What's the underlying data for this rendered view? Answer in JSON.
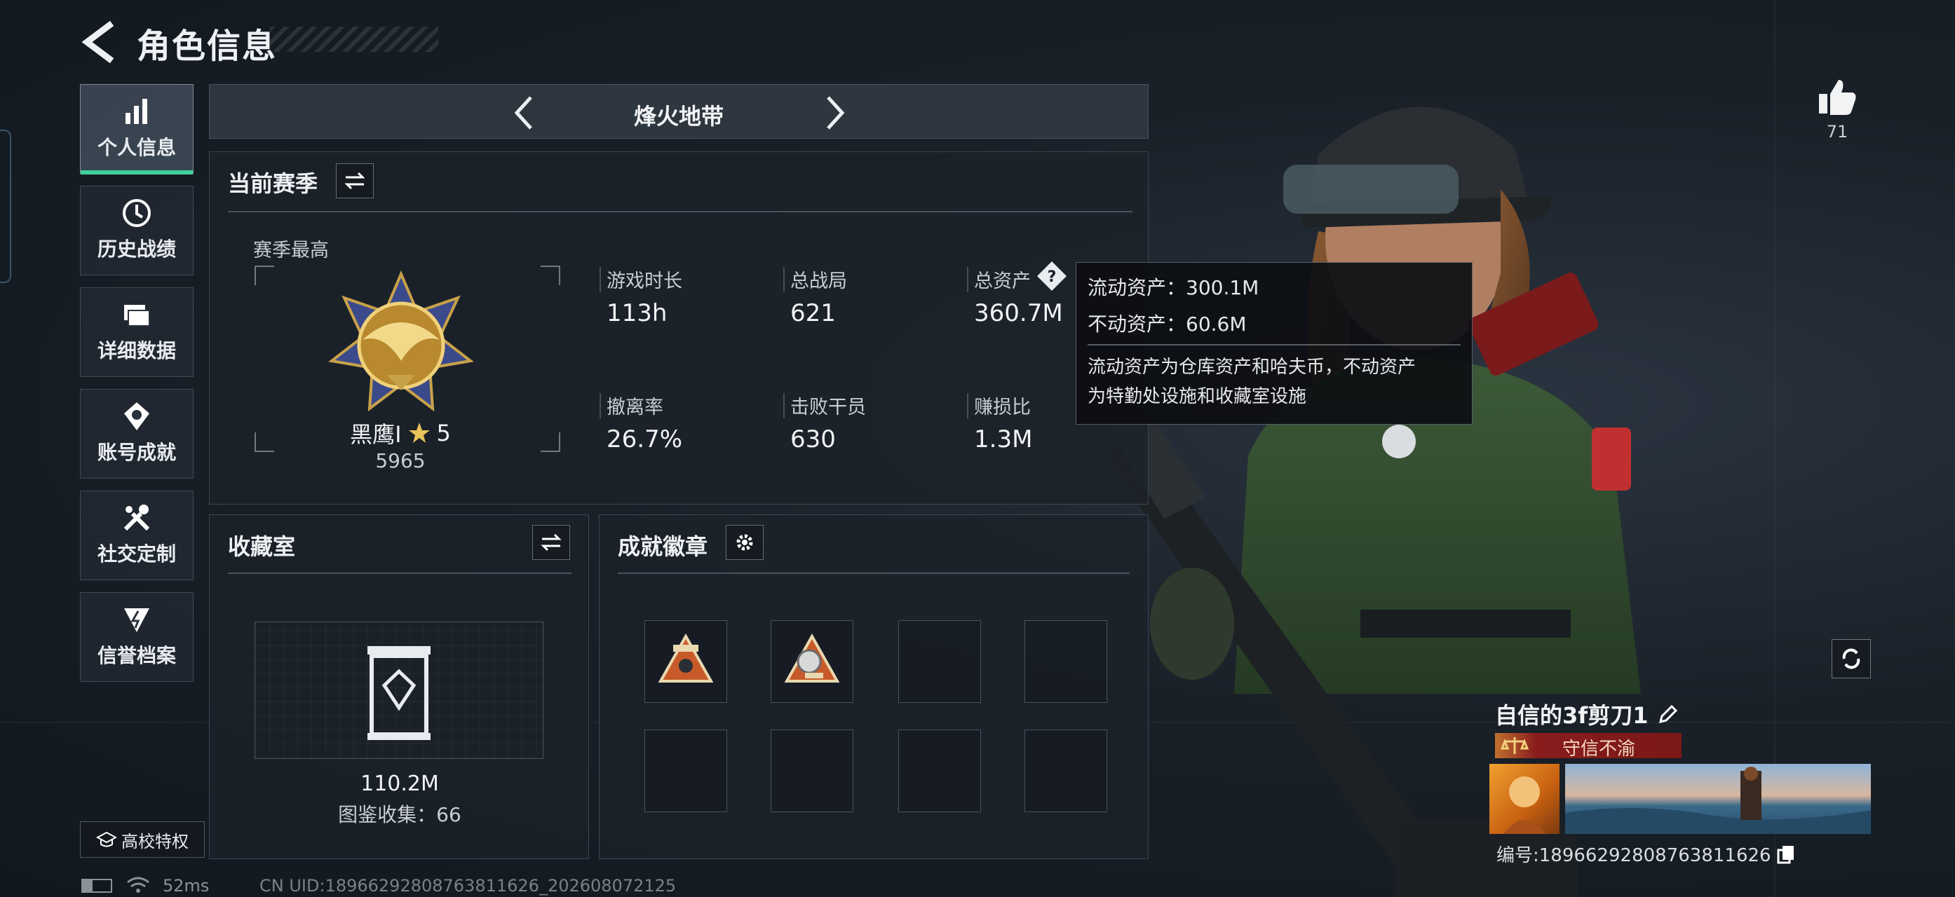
{
  "header": {
    "title": "角色信息"
  },
  "sidebar": {
    "items": [
      {
        "label": "个人信息",
        "icon": "bar-chart-icon",
        "active": true
      },
      {
        "label": "历史战绩",
        "icon": "clock-icon"
      },
      {
        "label": "详细数据",
        "icon": "folder-icon"
      },
      {
        "label": "账号成就",
        "icon": "medal-icon"
      },
      {
        "label": "社交定制",
        "icon": "tools-icon"
      },
      {
        "label": "信誉档案",
        "icon": "shield-bolt-icon"
      }
    ],
    "campus_label": "高校特权"
  },
  "mode_switcher": {
    "label": "烽火地带"
  },
  "season": {
    "title": "当前赛季",
    "best_label": "赛季最高",
    "rank_name": "黑鹰I",
    "rank_stars": "5",
    "rank_score": "5965",
    "stats": [
      {
        "label": "游戏时长",
        "value": "113h"
      },
      {
        "label": "总战局",
        "value": "621"
      },
      {
        "label": "总资产",
        "value": "360.7M"
      },
      {
        "label": "撤离率",
        "value": "26.7%"
      },
      {
        "label": "击败干员",
        "value": "630"
      },
      {
        "label": "赚损比",
        "value": "1.3M"
      }
    ]
  },
  "tooltip": {
    "liquid": "流动资产：300.1M",
    "fixed": "不动资产：60.6M",
    "desc_line1": "流动资产为仓库资产和哈夫币，不动资产",
    "desc_line2": "为特勤处设施和收藏室设施"
  },
  "collection": {
    "title": "收藏室",
    "value": "110.2M",
    "catalog": "图鉴收集：66"
  },
  "badges": {
    "title": "成就徽章",
    "filled": 2,
    "total": 8
  },
  "likes": {
    "count": "71"
  },
  "player": {
    "name": "自信的3f剪刀1",
    "tag": "守信不渝",
    "id_label": "编号:18966292808763811626"
  },
  "statusbar": {
    "ping": "52ms",
    "uid": "CN UID:18966292808763811626_202608072125"
  },
  "colors": {
    "accent": "#3fd19a",
    "tag_bg": "#8a1c1c",
    "gold": "#c8a24a"
  }
}
